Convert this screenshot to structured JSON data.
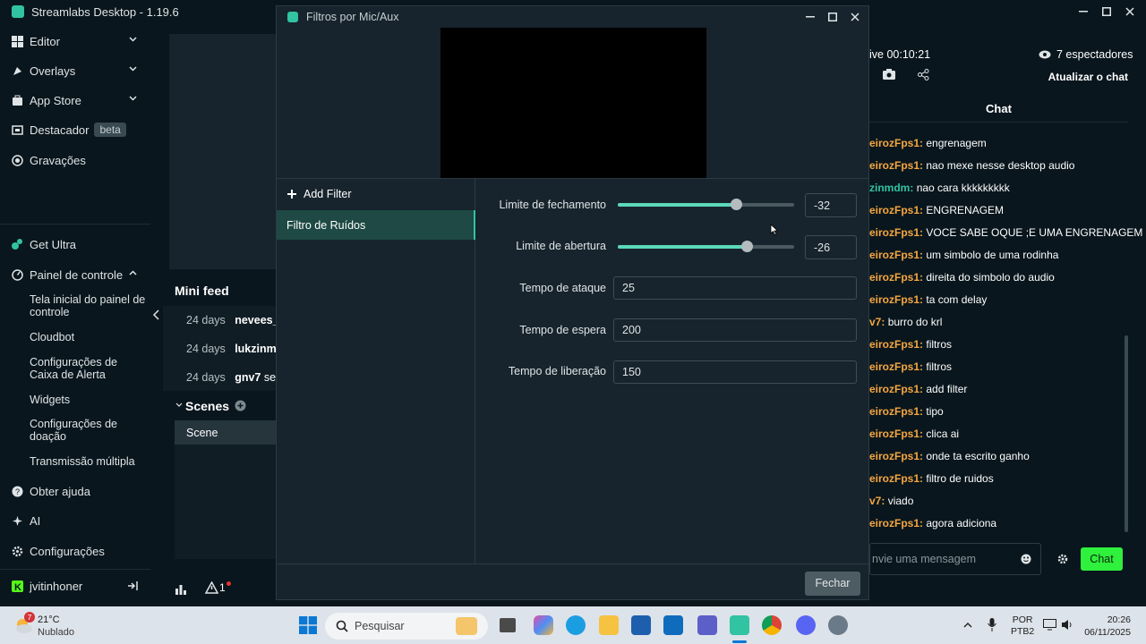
{
  "app": {
    "title": "Streamlabs Desktop - 1.19.6"
  },
  "sidebar": {
    "items": [
      {
        "label": "Editor"
      },
      {
        "label": "Overlays"
      },
      {
        "label": "App Store"
      },
      {
        "label": "Destacador",
        "badge": "beta"
      },
      {
        "label": "Gravações"
      },
      {
        "label": "Get Ultra"
      },
      {
        "label": "Painel de controle"
      },
      {
        "label": "Obter ajuda"
      },
      {
        "label": "AI"
      },
      {
        "label": "Configurações"
      }
    ],
    "subitems": [
      {
        "label": "Tela inicial do painel de controle"
      },
      {
        "label": "Cloudbot"
      },
      {
        "label": "Configurações de Caixa de Alerta"
      },
      {
        "label": "Widgets"
      },
      {
        "label": "Configurações de doação"
      },
      {
        "label": "Transmissão múltipla"
      }
    ],
    "user": "jvitinhoner"
  },
  "minifeed": {
    "title": "Mini feed",
    "rows": [
      {
        "time": "24 days",
        "name": "nevees_j"
      },
      {
        "time": "24 days",
        "name": "lukzinmc"
      },
      {
        "time": "24 days",
        "name": "gnv7",
        "extra": "se"
      }
    ]
  },
  "scenes": {
    "title": "Scenes",
    "item": "Scene"
  },
  "bottom": {
    "alert_count": "1"
  },
  "dialog": {
    "title": "Filtros por Mic/Aux",
    "add_filter": "Add Filter",
    "filter_item": "Filtro de Ruídos",
    "fields": {
      "close_threshold": {
        "label": "Limite de fechamento",
        "value": "-32",
        "level": 0.67
      },
      "open_threshold": {
        "label": "Limite de abertura",
        "value": "-26",
        "level": 0.73
      },
      "attack": {
        "label": "Tempo de ataque",
        "value": "25"
      },
      "hold": {
        "label": "Tempo de espera",
        "value": "200"
      },
      "release": {
        "label": "Tempo de liberação",
        "value": "150"
      }
    },
    "close_button": "Fechar"
  },
  "stream": {
    "live_time": "ive 00:10:21",
    "viewers": "7 espectadores",
    "refresh": "Atualizar o chat",
    "chat_title": "Chat",
    "chat_placeholder": "nvie uma mensagem",
    "chat_button": "Chat"
  },
  "chat": [
    {
      "user": "eirozFps1",
      "msg": "engrenagem"
    },
    {
      "user": "eirozFps1",
      "msg": "nao mexe nesse desktop audio"
    },
    {
      "user": "zinmdm",
      "msg": "nao cara kkkkkkkkk",
      "alt": true
    },
    {
      "user": "eirozFps1",
      "msg": "ENGRENAGEM"
    },
    {
      "user": "eirozFps1",
      "msg": "VOCE SABE OQUE ;E UMA ENGRENAGEM"
    },
    {
      "user": "eirozFps1",
      "msg": "um simbolo de uma rodinha"
    },
    {
      "user": "eirozFps1",
      "msg": "direita do simbolo do audio"
    },
    {
      "user": "eirozFps1",
      "msg": "ta com delay"
    },
    {
      "user": "v7",
      "msg": "burro do krl"
    },
    {
      "user": "eirozFps1",
      "msg": "filtros"
    },
    {
      "user": "eirozFps1",
      "msg": "filtros"
    },
    {
      "user": "eirozFps1",
      "msg": "add filter"
    },
    {
      "user": "eirozFps1",
      "msg": "tipo"
    },
    {
      "user": "eirozFps1",
      "msg": "clica ai"
    },
    {
      "user": "eirozFps1",
      "msg": "onde ta escrito ganho"
    },
    {
      "user": "eirozFps1",
      "msg": "filtro de ruidos"
    },
    {
      "user": "v7",
      "msg": "viado"
    },
    {
      "user": "eirozFps1",
      "msg": "agora adiciona"
    }
  ],
  "taskbar": {
    "weather_temp": "21°C",
    "weather_desc": "Nublado",
    "weather_badge": "7",
    "search": "Pesquisar",
    "lang1": "POR",
    "lang2": "PTB2",
    "time": "20:26",
    "date": "06/11/2025"
  },
  "colors": {
    "accent": "#31c3a2",
    "bg": "#09161d",
    "panel": "#17242d",
    "username": "#f6a740",
    "chat_btn": "#2ff03c"
  }
}
